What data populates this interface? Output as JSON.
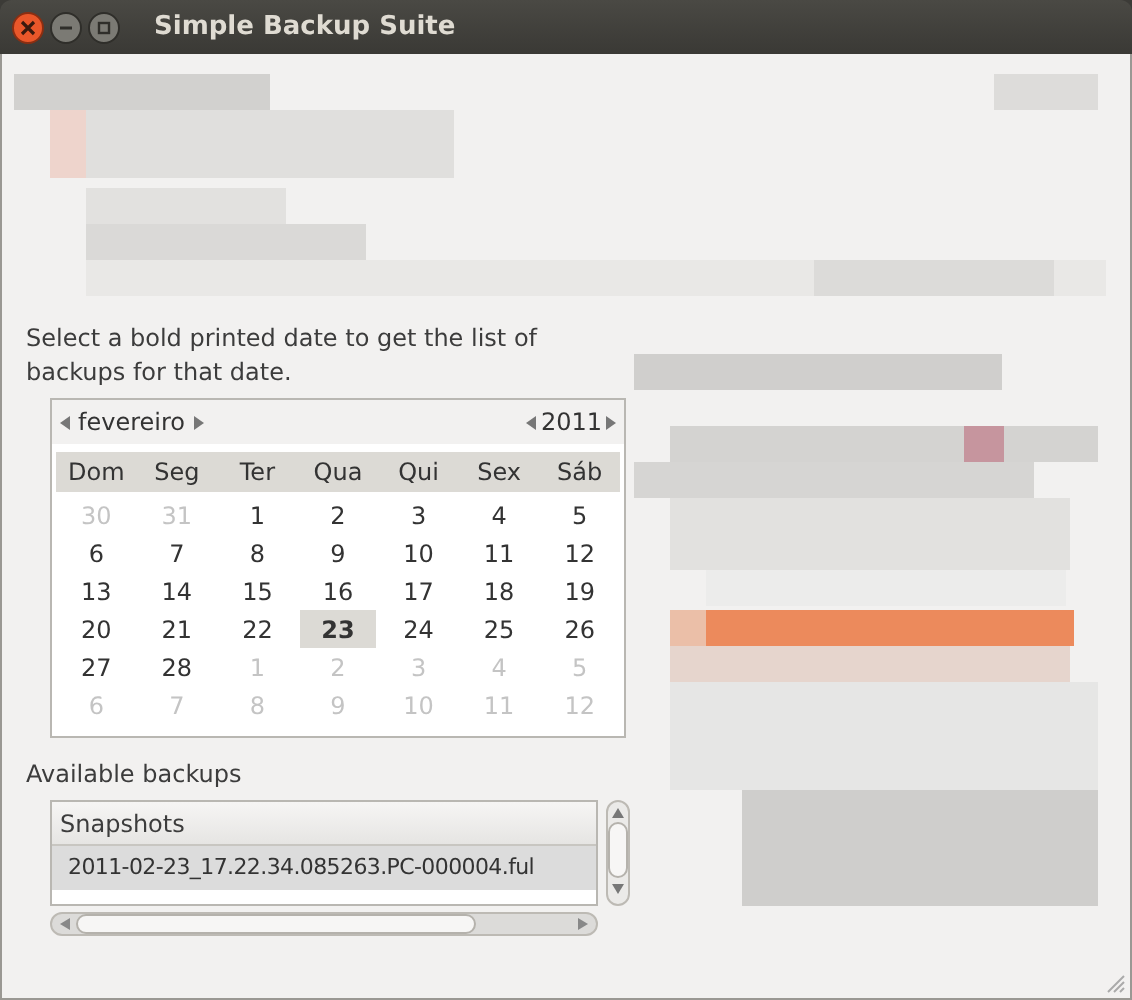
{
  "window": {
    "title": "Simple Backup Suite"
  },
  "instructions": "Select a bold printed date to get the list of backups for that date.",
  "calendar": {
    "month": "fevereiro",
    "year": "2011",
    "weekdays": [
      "Dom",
      "Seg",
      "Ter",
      "Qua",
      "Qui",
      "Sex",
      "Sáb"
    ],
    "weeks": [
      [
        {
          "day": "30",
          "other_month": true,
          "selected": false
        },
        {
          "day": "31",
          "other_month": true,
          "selected": false
        },
        {
          "day": "1",
          "other_month": false,
          "selected": false
        },
        {
          "day": "2",
          "other_month": false,
          "selected": false
        },
        {
          "day": "3",
          "other_month": false,
          "selected": false
        },
        {
          "day": "4",
          "other_month": false,
          "selected": false
        },
        {
          "day": "5",
          "other_month": false,
          "selected": false
        }
      ],
      [
        {
          "day": "6",
          "other_month": false,
          "selected": false
        },
        {
          "day": "7",
          "other_month": false,
          "selected": false
        },
        {
          "day": "8",
          "other_month": false,
          "selected": false
        },
        {
          "day": "9",
          "other_month": false,
          "selected": false
        },
        {
          "day": "10",
          "other_month": false,
          "selected": false
        },
        {
          "day": "11",
          "other_month": false,
          "selected": false
        },
        {
          "day": "12",
          "other_month": false,
          "selected": false
        }
      ],
      [
        {
          "day": "13",
          "other_month": false,
          "selected": false
        },
        {
          "day": "14",
          "other_month": false,
          "selected": false
        },
        {
          "day": "15",
          "other_month": false,
          "selected": false
        },
        {
          "day": "16",
          "other_month": false,
          "selected": false
        },
        {
          "day": "17",
          "other_month": false,
          "selected": false
        },
        {
          "day": "18",
          "other_month": false,
          "selected": false
        },
        {
          "day": "19",
          "other_month": false,
          "selected": false
        }
      ],
      [
        {
          "day": "20",
          "other_month": false,
          "selected": false
        },
        {
          "day": "21",
          "other_month": false,
          "selected": false
        },
        {
          "day": "22",
          "other_month": false,
          "selected": false
        },
        {
          "day": "23",
          "other_month": false,
          "selected": true
        },
        {
          "day": "24",
          "other_month": false,
          "selected": false
        },
        {
          "day": "25",
          "other_month": false,
          "selected": false
        },
        {
          "day": "26",
          "other_month": false,
          "selected": false
        }
      ],
      [
        {
          "day": "27",
          "other_month": false,
          "selected": false
        },
        {
          "day": "28",
          "other_month": false,
          "selected": false
        },
        {
          "day": "1",
          "other_month": true,
          "selected": false
        },
        {
          "day": "2",
          "other_month": true,
          "selected": false
        },
        {
          "day": "3",
          "other_month": true,
          "selected": false
        },
        {
          "day": "4",
          "other_month": true,
          "selected": false
        },
        {
          "day": "5",
          "other_month": true,
          "selected": false
        }
      ],
      [
        {
          "day": "6",
          "other_month": true,
          "selected": false
        },
        {
          "day": "7",
          "other_month": true,
          "selected": false
        },
        {
          "day": "8",
          "other_month": true,
          "selected": false
        },
        {
          "day": "9",
          "other_month": true,
          "selected": false
        },
        {
          "day": "10",
          "other_month": true,
          "selected": false
        },
        {
          "day": "11",
          "other_month": true,
          "selected": false
        },
        {
          "day": "12",
          "other_month": true,
          "selected": false
        }
      ]
    ]
  },
  "backups": {
    "label": "Available backups",
    "column": "Snapshots",
    "rows": [
      {
        "name": "2011-02-23_17.22.34.085263.PC-000004.ful",
        "selected": true
      }
    ]
  }
}
